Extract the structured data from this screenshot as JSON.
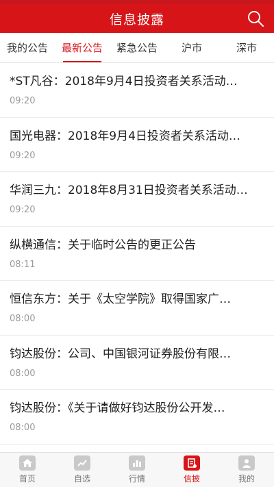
{
  "header": {
    "title": "信息披露",
    "search_icon": "search-icon"
  },
  "tabs": [
    {
      "label": "我的公告",
      "active": false
    },
    {
      "label": "最新公告",
      "active": true
    },
    {
      "label": "紧急公告",
      "active": false
    },
    {
      "label": "沪市",
      "active": false
    },
    {
      "label": "深市",
      "active": false
    }
  ],
  "announcements": [
    {
      "title": "*ST凡谷：2018年9月4日投资者关系活动…",
      "time": "09:20"
    },
    {
      "title": "国光电器：2018年9月4日投资者关系活动…",
      "time": "09:20"
    },
    {
      "title": "华润三九：2018年8月31日投资者关系活动…",
      "time": "09:20"
    },
    {
      "title": "纵横通信：关于临时公告的更正公告",
      "time": "08:11"
    },
    {
      "title": "恒信东方：关于《太空学院》取得国家广…",
      "time": "08:00"
    },
    {
      "title": "钧达股份：公司、中国银河证券股份有限…",
      "time": "08:00"
    },
    {
      "title": "钧达股份：《关于请做好钧达股份公开发…",
      "time": "08:00"
    }
  ],
  "tabbar": [
    {
      "label": "首页",
      "icon": "home-icon",
      "active": false
    },
    {
      "label": "自选",
      "icon": "trend-icon",
      "active": false
    },
    {
      "label": "行情",
      "icon": "bar-chart-icon",
      "active": false
    },
    {
      "label": "信披",
      "icon": "document-icon",
      "active": true
    },
    {
      "label": "我的",
      "icon": "user-icon",
      "active": false
    }
  ],
  "colors": {
    "brand": "#d71518"
  }
}
